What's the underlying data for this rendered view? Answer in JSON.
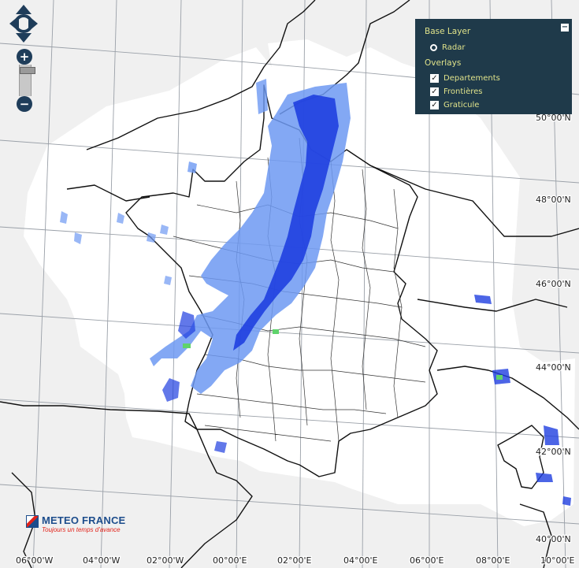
{
  "layer_switcher": {
    "base_layer_title": "Base Layer",
    "base_layers": [
      {
        "label": "Radar",
        "selected": true
      }
    ],
    "overlays_title": "Overlays",
    "overlays": [
      {
        "label": "Departements",
        "checked": true
      },
      {
        "label": "Frontières",
        "checked": true
      },
      {
        "label": "Graticule",
        "checked": true
      }
    ],
    "minimize_symbol": "−"
  },
  "zoom": {
    "in_symbol": "+",
    "out_symbol": "−",
    "level_fraction": 0.1
  },
  "graticule": {
    "latitude_labels": [
      "50°00'N",
      "48°00'N",
      "46°00'N",
      "44°00'N",
      "42°00'N",
      "40°00'N"
    ],
    "longitude_labels": [
      "06°00'W",
      "04°00'W",
      "02°00'W",
      "00°00'E",
      "02°00'E",
      "04°00'E",
      "06°00'E",
      "08°00'E",
      "10°00'E"
    ]
  },
  "logo": {
    "name": "METEO FRANCE",
    "tagline": "Toujours un temps d'avance"
  },
  "colors": {
    "ocean_background": "#f0f0f0",
    "radar_coverage": "#ffffff",
    "precip_light": "#6d99f2",
    "precip_moderate": "#1f3fe0",
    "precip_heavy": "#5fd36b",
    "panel": "#1f3a4a",
    "panel_text": "#dfe28a",
    "graticule": "#9aa0a8"
  }
}
